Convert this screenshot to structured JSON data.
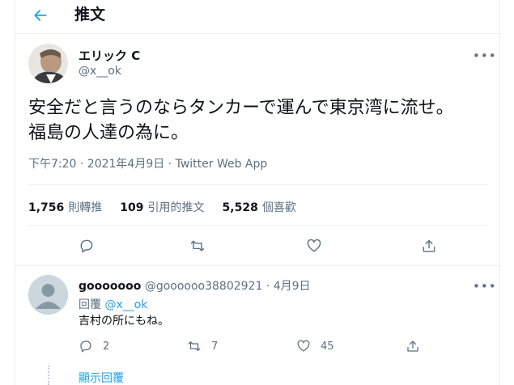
{
  "header": {
    "title": "推文"
  },
  "tweet": {
    "author_name": "エリック C",
    "author_handle": "@x__ok",
    "text_line1": "安全だと言うのならタンカーで運んで東京湾に流せ。",
    "text_line2": "福島の人達の為に。",
    "timestamp": "下午7:20 · 2021年4月9日 · Twitter Web App",
    "stats": {
      "retweets_count": "1,756",
      "retweets_label": "則轉推",
      "quotes_count": "109",
      "quotes_label": "引用的推文",
      "likes_count": "5,528",
      "likes_label": "個喜歡"
    },
    "more_label": "•••"
  },
  "reply": {
    "author_name": "gooooooo",
    "author_handle_time": "@goooooo38802921 · 4月9日",
    "replying_prefix": "回覆",
    "replying_to": "@x__ok",
    "text": "吉村の所にもね。",
    "reply_count": "2",
    "retweet_count": "7",
    "like_count": "45",
    "more_label": "•••"
  },
  "show_replies_label": "顯示回覆",
  "colors": {
    "accent": "#1da1f2",
    "secondary_text": "#5b7083",
    "border": "#ebeef0"
  },
  "icons": [
    "back-arrow-icon",
    "more-icon",
    "reply-icon",
    "retweet-icon",
    "like-icon",
    "share-icon"
  ]
}
